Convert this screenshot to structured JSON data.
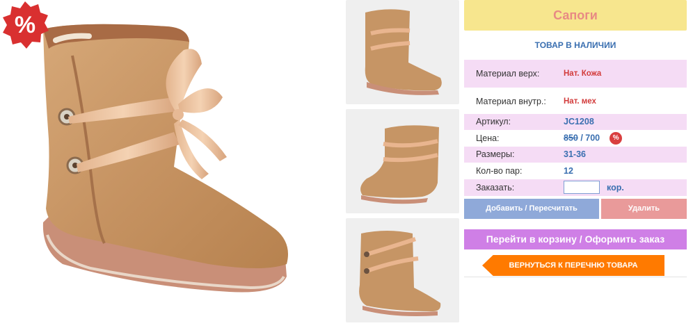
{
  "product": {
    "title": "Сапоги",
    "stock": "ТОВАР В НАЛИЧИИ",
    "sale_badge": "%"
  },
  "specs": {
    "material_top_label": "Материал верх:",
    "material_top_value": "Нат. Кожа",
    "material_inner_label": "Материал внутр.:",
    "material_inner_value": "Нат. мех",
    "sku_label": "Артикул:",
    "sku_value": "JC1208",
    "price_label": "Цена:",
    "price_old": "850",
    "price_sep": " / ",
    "price_new": "700",
    "price_badge": "%",
    "sizes_label": "Размеры:",
    "sizes_value": "31-36",
    "pairs_label": "Кол-во пар:",
    "pairs_value": "12",
    "order_label": "Заказать:",
    "order_value": "",
    "order_unit": "кор."
  },
  "buttons": {
    "add": "Добавить / Пересчитать",
    "delete": "Удалить",
    "cart": "Перейти в корзину / Оформить заказ",
    "back": "ВЕРНУТЬСЯ К ПЕРЕЧНЮ ТОВАРА"
  },
  "colors": {
    "title_bg": "#f7e68e",
    "row_pink": "#f5dcf5",
    "accent_blue": "#3a6fb0",
    "cart_button": "#cf7fe6",
    "back_button": "#ff7a00"
  }
}
